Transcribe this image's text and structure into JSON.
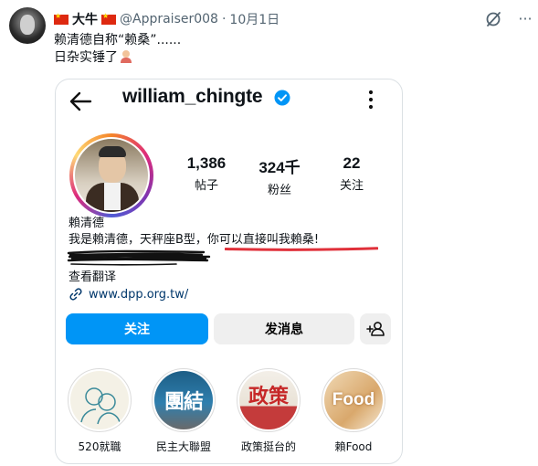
{
  "tweet": {
    "display_name": "大牛",
    "handle": "@Appraiser008",
    "separator": "·",
    "date": "10月1日",
    "text_line1": "赖清德自称“赖桑”......",
    "text_line2": "日杂实锤了"
  },
  "ig": {
    "username": "william_chingte",
    "stats": [
      {
        "value": "1,386",
        "label": "帖子"
      },
      {
        "value": "324千",
        "label": "粉丝"
      },
      {
        "value": "22",
        "label": "关注"
      }
    ],
    "bio_name": "賴清德",
    "bio_line_a": "我是賴清德，天秤座B型，",
    "bio_line_b": "你可以直接叫我賴桑!",
    "see_translation": "查看翻译",
    "website": "www.dpp.org.tw/",
    "follow_label": "关注",
    "message_label": "发消息",
    "highlights": [
      {
        "label": "520就職",
        "image_text": ""
      },
      {
        "label": "民主大聯盟",
        "image_text": "團結"
      },
      {
        "label": "政策挺台的",
        "image_text": "政策"
      },
      {
        "label": "賴Food",
        "image_text": "Food"
      }
    ]
  },
  "colors": {
    "accent": "#0095f6",
    "verified": "#0095f6",
    "underline": "#e0303a",
    "muted": "#536471"
  }
}
